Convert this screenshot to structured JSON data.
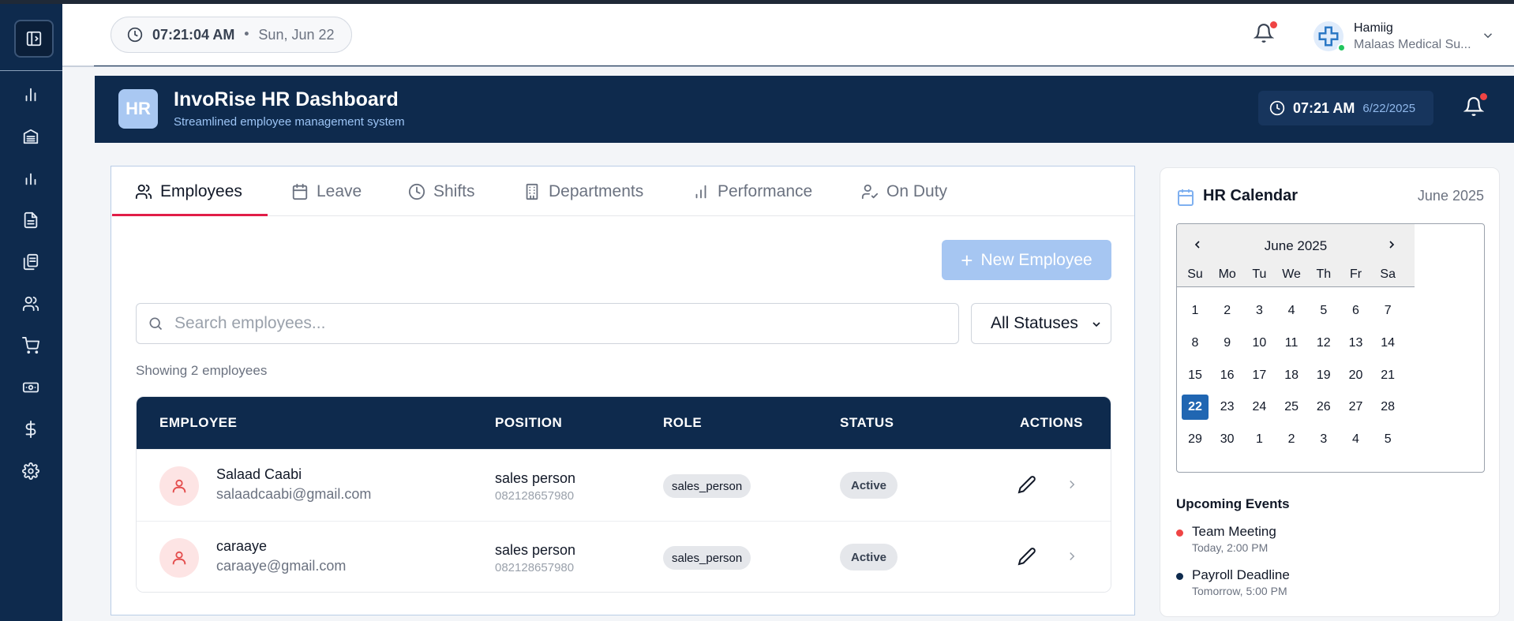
{
  "header": {
    "time": "07:21:04 AM",
    "separator": "•",
    "date": "Sun, Jun 22",
    "user": {
      "name": "Hamiig",
      "org": "Malaas Medical Su..."
    }
  },
  "sidebar": {
    "items": [
      {
        "icon": "bar-chart-icon"
      },
      {
        "icon": "warehouse-icon"
      },
      {
        "icon": "stats-icon"
      },
      {
        "icon": "document-icon"
      },
      {
        "icon": "files-icon"
      },
      {
        "icon": "users-icon"
      },
      {
        "icon": "cart-icon"
      },
      {
        "icon": "cash-icon"
      },
      {
        "icon": "dollar-icon"
      },
      {
        "icon": "settings-icon"
      }
    ]
  },
  "banner": {
    "logo": "HR",
    "title": "InvoRise HR Dashboard",
    "subtitle": "Streamlined employee management system",
    "time": "07:21 AM",
    "date": "6/22/2025"
  },
  "tabs": [
    {
      "label": "Employees",
      "icon": "users-icon",
      "active": true
    },
    {
      "label": "Leave",
      "icon": "calendar-icon",
      "active": false
    },
    {
      "label": "Shifts",
      "icon": "clock-icon",
      "active": false
    },
    {
      "label": "Departments",
      "icon": "building-icon",
      "active": false
    },
    {
      "label": "Performance",
      "icon": "bar-chart-icon",
      "active": false
    },
    {
      "label": "On Duty",
      "icon": "user-check-icon",
      "active": false
    }
  ],
  "toolbar": {
    "new_employee_plus": "+",
    "new_employee_label": "New Employee",
    "search_placeholder": "Search employees...",
    "status_filter": "All Statuses",
    "showing_text": "Showing 2 employees"
  },
  "table": {
    "columns": [
      "EMPLOYEE",
      "POSITION",
      "ROLE",
      "STATUS",
      "ACTIONS"
    ],
    "rows": [
      {
        "name": "Salaad Caabi",
        "email": "salaadcaabi@gmail.com",
        "position": "sales person",
        "phone": "082128657980",
        "role": "sales_person",
        "status": "Active"
      },
      {
        "name": "caraaye",
        "email": "caraaye@gmail.com",
        "position": "sales person",
        "phone": "082128657980",
        "role": "sales_person",
        "status": "Active"
      }
    ]
  },
  "calendar": {
    "title": "HR Calendar",
    "month_label": "June 2025",
    "nav_title": "June 2025",
    "days_of_week": [
      "Su",
      "Mo",
      "Tu",
      "We",
      "Th",
      "Fr",
      "Sa"
    ],
    "weeks": [
      [
        "1",
        "2",
        "3",
        "4",
        "5",
        "6",
        "7"
      ],
      [
        "8",
        "9",
        "10",
        "11",
        "12",
        "13",
        "14"
      ],
      [
        "15",
        "16",
        "17",
        "18",
        "19",
        "20",
        "21"
      ],
      [
        "22",
        "23",
        "24",
        "25",
        "26",
        "27",
        "28"
      ],
      [
        "29",
        "30",
        "1",
        "2",
        "3",
        "4",
        "5"
      ]
    ],
    "selected_day": "22"
  },
  "events": {
    "title": "Upcoming Events",
    "items": [
      {
        "name": "Team Meeting",
        "time": "Today, 2:00 PM",
        "color": "#ef4444"
      },
      {
        "name": "Payroll Deadline",
        "time": "Tomorrow, 5:00 PM",
        "color": "#0e2a4d"
      }
    ]
  },
  "colors": {
    "navy": "#0e2a4d",
    "accent_red": "#e11d48",
    "button_blue": "#a6c6f2",
    "selected_day": "#2066b2"
  }
}
